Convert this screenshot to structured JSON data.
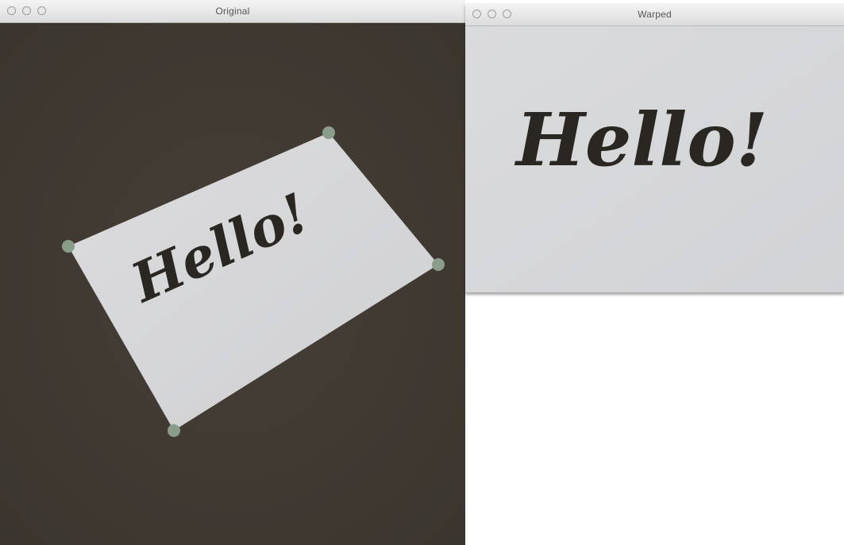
{
  "windows": {
    "original": {
      "title": "Original",
      "background_color": "#3f3a33",
      "card_color": "#d6d6d8",
      "corner_marker_color": "#8a9d8b",
      "card_text": "Hello!"
    },
    "warped": {
      "title": "Warped",
      "background_color": "#d7d8da",
      "card_text": "Hello!"
    }
  }
}
